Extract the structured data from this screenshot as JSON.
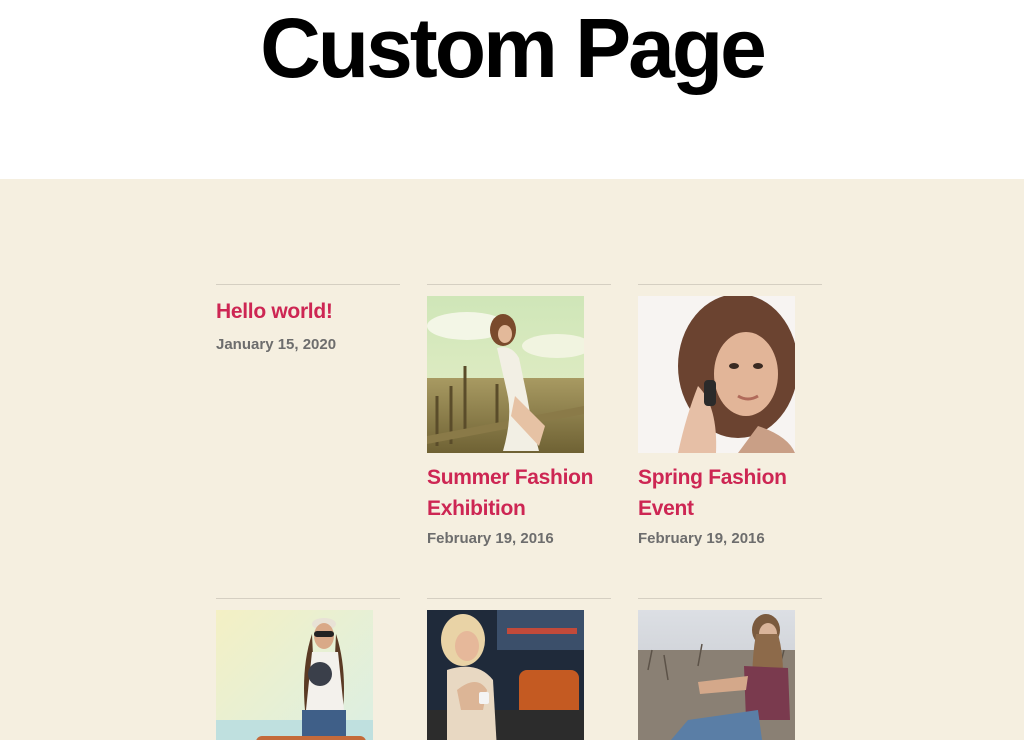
{
  "page": {
    "title": "Custom Page"
  },
  "colors": {
    "title": "#000000",
    "content_background": "#f5efe0",
    "post_title": "#cd2653",
    "post_date": "#6d6d6d",
    "divider": "#d5cfc2"
  },
  "posts": [
    {
      "title": "Hello world!",
      "date": "January 15, 2020",
      "image": "none"
    },
    {
      "title": "Summer Fashion Exhibition",
      "date": "February 19, 2016",
      "image": "woman-sitting-on-fence-photo"
    },
    {
      "title": "Spring Fashion Event",
      "date": "February 19, 2016",
      "image": "woman-on-phone-portrait-photo"
    },
    {
      "title": "",
      "date": "",
      "image": "woman-with-sunglasses-cap-photo"
    },
    {
      "title": "",
      "date": "",
      "image": "woman-in-cafe-photo"
    },
    {
      "title": "",
      "date": "",
      "image": "woman-sitting-in-field-photo"
    }
  ]
}
